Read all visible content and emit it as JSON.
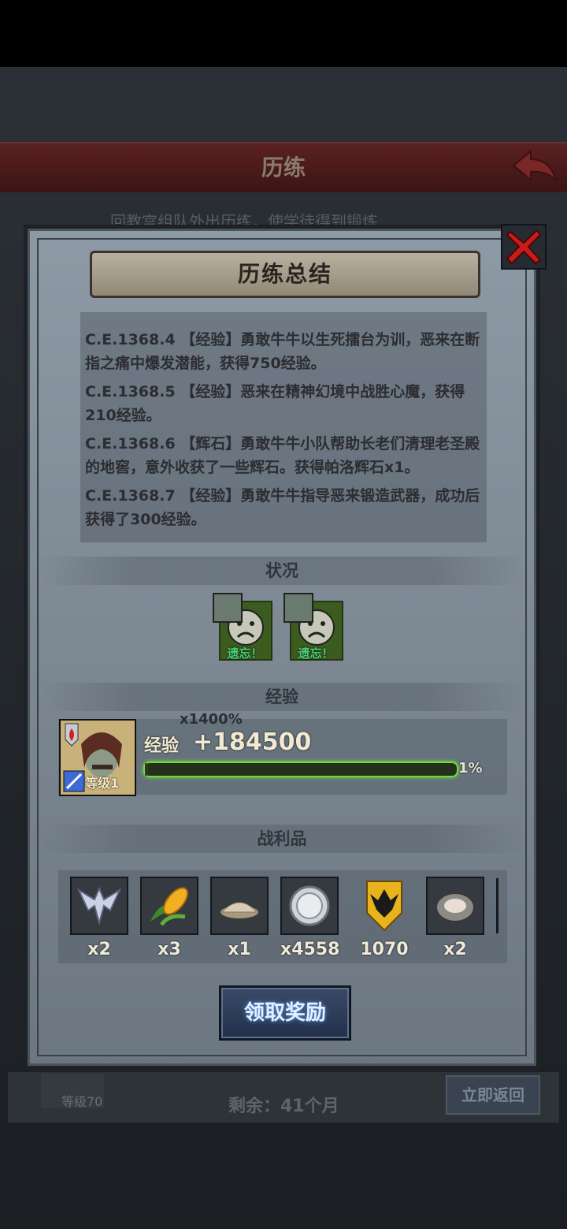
{
  "background": {
    "header_title": "历练",
    "subtitle": "回教宫组队外出历练，使学徒得到锻炼",
    "remaining": "剩余：41个月",
    "return_button": "立即返回",
    "level_label": "等级70"
  },
  "dialog": {
    "title": "历练总结",
    "log": [
      "C.E.1368.4 【经验】勇敢牛牛以生死擂台为训，恶来在断指之痛中爆发潜能，获得750经验。",
      "C.E.1368.5 【经验】恶来在精神幻境中战胜心魔，获得210经验。",
      "C.E.1368.6 【辉石】勇敢牛牛小队帮助长老们清理老圣殿的地窖，意外收获了一些辉石。获得帕洛辉石x1。",
      "C.E.1368.7 【经验】勇敢牛牛指导恶来锻造武器，成功后获得了300经验。"
    ],
    "status_section": "状况",
    "status_cards": [
      "遗忘！",
      "遗忘！"
    ],
    "exp_section": "经验",
    "hero": {
      "level": "等级1",
      "multiplier": "x1400%",
      "exp_label": "经验",
      "exp_gain": "+184500",
      "progress_percent": "1%",
      "progress_value": 1
    },
    "loot_section": "战利品",
    "loot": [
      {
        "icon": "winged-helm-icon",
        "count": "x2"
      },
      {
        "icon": "corn-icon",
        "count": "x3"
      },
      {
        "icon": "flour-pile-icon",
        "count": "x1"
      },
      {
        "icon": "silver-coin-icon",
        "count": "x4558"
      },
      {
        "icon": "eagle-crest-icon",
        "count": "1070"
      },
      {
        "icon": "oyster-icon",
        "count": "x2"
      }
    ],
    "claim_button": "领取奖励"
  },
  "colors": {
    "accent_green": "#6cdc3a",
    "close_red": "#c81c1c",
    "status_green": "#4ad07a"
  }
}
